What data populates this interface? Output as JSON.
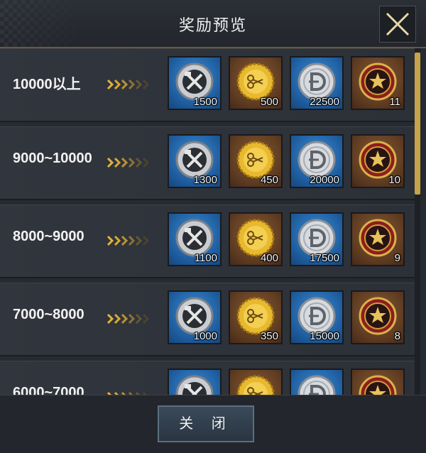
{
  "header": {
    "title": "奖励预览",
    "close_icon": "close-x-icon"
  },
  "reward_icons": [
    "hammer-wrench-medal-icon",
    "gold-scissors-medal-icon",
    "silver-coin-icon",
    "red-star-crown-medal-icon"
  ],
  "rows": [
    {
      "label": "10000以上",
      "rewards": [
        "1500",
        "500",
        "22500",
        "11"
      ]
    },
    {
      "label": "9000~10000",
      "rewards": [
        "1300",
        "450",
        "20000",
        "10"
      ]
    },
    {
      "label": "8000~9000",
      "rewards": [
        "1100",
        "400",
        "17500",
        "9"
      ]
    },
    {
      "label": "7000~8000",
      "rewards": [
        "1000",
        "350",
        "15000",
        "8"
      ]
    },
    {
      "label": "6000~7000",
      "rewards": [
        "",
        "",
        "",
        ""
      ]
    }
  ],
  "footer": {
    "close_label": "关 闭"
  },
  "colors": {
    "accent_gold": "#c8a24a",
    "item_blue": "#2a6fb5",
    "item_brown": "#6b4426"
  }
}
